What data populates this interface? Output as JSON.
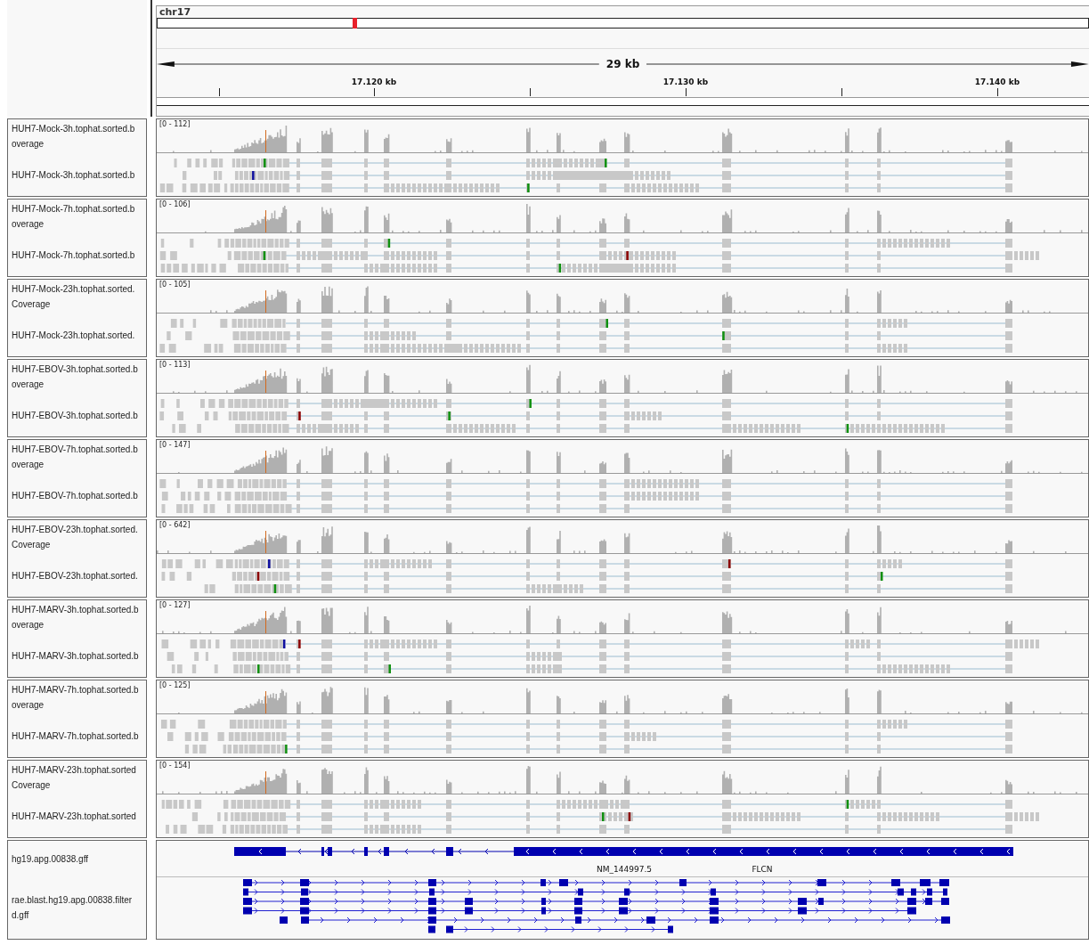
{
  "ruler": {
    "chromosome": "chr17",
    "span": "29 kb",
    "ticks": [
      "17.120 kb",
      "17.130 kb",
      "17.140 kb"
    ]
  },
  "tracks": [
    {
      "coverage_label": [
        "HUH7-Mock-3h.tophat.sorted.b",
        "overage"
      ],
      "reads_label": "HUH7-Mock-3h.tophat.sorted.b",
      "range": "[0 - 112]"
    },
    {
      "coverage_label": [
        "HUH7-Mock-7h.tophat.sorted.b",
        "overage"
      ],
      "reads_label": "HUH7-Mock-7h.tophat.sorted.b",
      "range": "[0 - 106]"
    },
    {
      "coverage_label": [
        "HUH7-Mock-23h.tophat.sorted.",
        "Coverage"
      ],
      "reads_label": "HUH7-Mock-23h.tophat.sorted.",
      "range": "[0 - 105]"
    },
    {
      "coverage_label": [
        "HUH7-EBOV-3h.tophat.sorted.b",
        "overage"
      ],
      "reads_label": "HUH7-EBOV-3h.tophat.sorted.b",
      "range": "[0 - 113]"
    },
    {
      "coverage_label": [
        "HUH7-EBOV-7h.tophat.sorted.b",
        "overage"
      ],
      "reads_label": "HUH7-EBOV-7h.tophat.sorted.b",
      "range": "[0 - 147]"
    },
    {
      "coverage_label": [
        "HUH7-EBOV-23h.tophat.sorted.",
        "Coverage"
      ],
      "reads_label": "HUH7-EBOV-23h.tophat.sorted.",
      "range": "[0 - 642]"
    },
    {
      "coverage_label": [
        "HUH7-MARV-3h.tophat.sorted.b",
        "overage"
      ],
      "reads_label": "HUH7-MARV-3h.tophat.sorted.b",
      "range": "[0 - 127]"
    },
    {
      "coverage_label": [
        "HUH7-MARV-7h.tophat.sorted.b",
        "overage"
      ],
      "reads_label": "HUH7-MARV-7h.tophat.sorted.b",
      "range": "[0 - 125]"
    },
    {
      "coverage_label": [
        "HUH7-MARV-23h.tophat.sorted",
        "Coverage"
      ],
      "reads_label": "HUH7-MARV-23h.tophat.sorted",
      "range": "[0 - 154]"
    }
  ],
  "annotations": {
    "gene_track_label": "hg19.apg.00838.gff",
    "feature_labels": [
      "NM_144997.5",
      "FLCN"
    ],
    "blast_track_label": [
      "rae.blast.hg19.apg.00838.filter",
      "d.gff"
    ]
  }
}
